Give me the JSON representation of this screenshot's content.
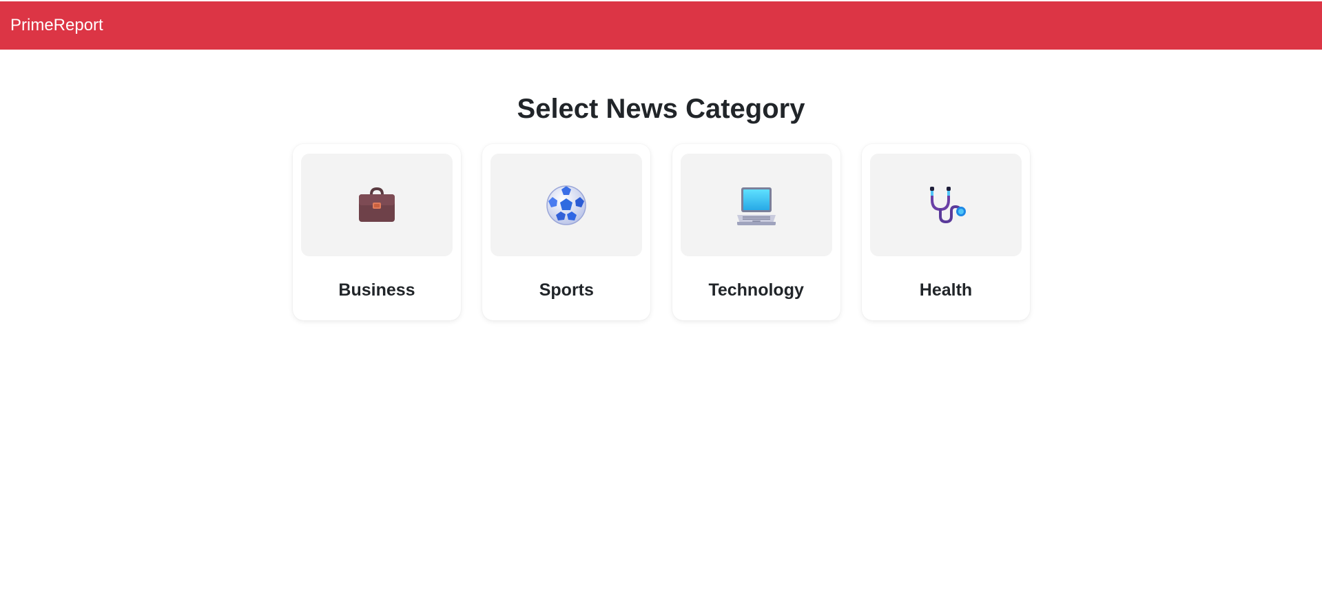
{
  "navbar": {
    "brand": "PrimeReport",
    "background_color": "#dc3545"
  },
  "main": {
    "title": "Select News Category",
    "categories": [
      {
        "label": "Business",
        "icon": "briefcase-icon"
      },
      {
        "label": "Sports",
        "icon": "soccer-ball-icon"
      },
      {
        "label": "Technology",
        "icon": "laptop-icon"
      },
      {
        "label": "Health",
        "icon": "stethoscope-icon"
      }
    ]
  }
}
